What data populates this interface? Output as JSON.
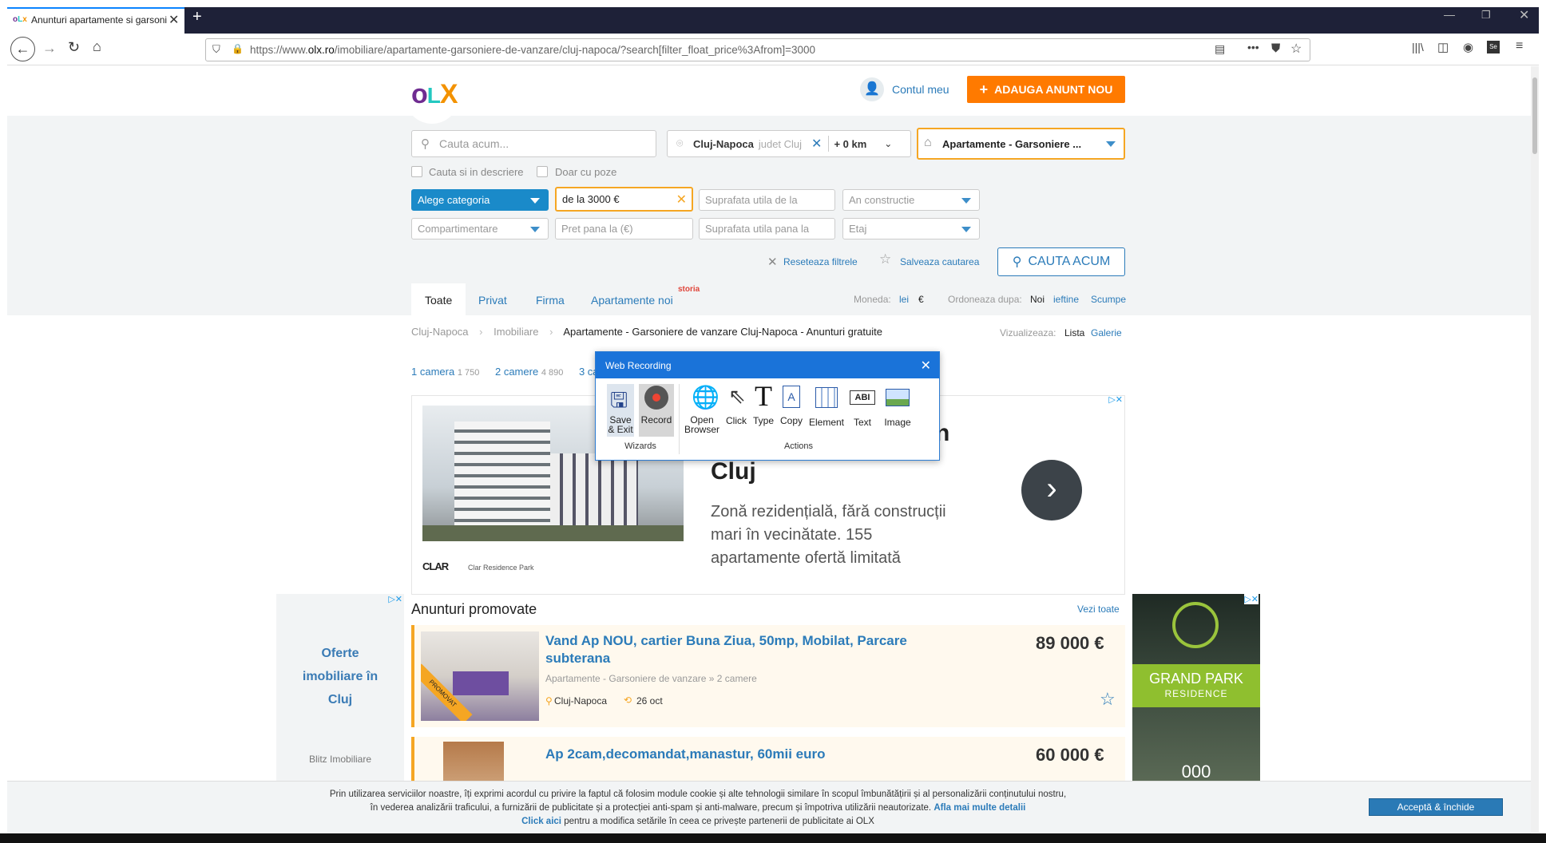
{
  "browser": {
    "tab_title": "Anunturi apartamente si garsoniere",
    "url_prefix": "https://www.",
    "url_domain": "olx.ro",
    "url_path": "/imobiliare/apartamente-garsoniere-de-vanzare/cluj-napoca/?search[filter_float_price%3Afrom]=3000"
  },
  "header": {
    "logo": "OLX",
    "account": "Contul meu",
    "post_ad": "ADAUGA ANUNT NOU"
  },
  "search": {
    "query_placeholder": "Cauta acum...",
    "city": "Cluj-Napoca",
    "county": "judet Cluj",
    "radius": "+ 0 km",
    "category": "Apartamente - Garsoniere ...",
    "desc_checkbox": "Cauta si in descriere",
    "photo_checkbox": "Doar cu poze",
    "subcategory": "Alege categoria",
    "price_from": "de la 3000 €",
    "area_from": "Suprafata utila de la",
    "year": "An constructie",
    "partitioning": "Compartimentare",
    "price_to": "Pret pana la (€)",
    "area_to": "Suprafata utila pana la",
    "floor": "Etaj",
    "reset": "Reseteaza filtrele",
    "save": "Salveaza cautarea",
    "submit": "CAUTA ACUM"
  },
  "tabs": [
    "Toate",
    "Privat",
    "Firma",
    "Apartamente noi"
  ],
  "storia": "storia",
  "currency": {
    "label": "Moneda:",
    "lei": "lei",
    "eur": "€"
  },
  "sort": {
    "label": "Ordoneaza dupa:",
    "new": "Noi",
    "cheap": "ieftine",
    "expensive": "Scumpe"
  },
  "breadcrumb": [
    "Cluj-Napoca",
    "Imobiliare",
    "Apartamente - Garsoniere de vanzare Cluj-Napoca - Anunturi gratuite"
  ],
  "view": {
    "label": "Vizualizeaza:",
    "list": "Lista",
    "gallery": "Galerie"
  },
  "rooms": [
    {
      "label": "1 camera",
      "count": "1 750"
    },
    {
      "label": "2 camere",
      "count": "4 890"
    },
    {
      "label": "3 ca",
      "count": ""
    }
  ],
  "ad_banner": {
    "title_tail": "n",
    "title_line2": "Cluj",
    "body": [
      "Zonă rezidențială, fără construcții",
      "mari în vecinătate. 155",
      "apartamente ofertă limitată"
    ],
    "brand": "CLAR",
    "brand_sub": "Clar Residence Park"
  },
  "left_ad": {
    "title": [
      "Oferte",
      "imobiliare în",
      "Cluj"
    ],
    "source": "Blitz Imobiliare"
  },
  "right_ad": {
    "brand": "GRAND PARK",
    "sub": "RESIDENCE",
    "num": "000"
  },
  "promoted": {
    "heading": "Anunturi promovate",
    "see_all": "Vezi toate",
    "items": [
      {
        "title": [
          "Vand Ap NOU, cartier Buna Ziua, 50mp, Mobilat, Parcare",
          "subterana"
        ],
        "category": "Apartamente - Garsoniere de vanzare » 2 camere",
        "location": "Cluj-Napoca",
        "date": "26 oct",
        "price": "89 000 €",
        "badge": "PROMOVAT"
      },
      {
        "title": [
          "Ap 2cam,decomandat,manastur, 60mii euro"
        ],
        "price": "60 000 €"
      }
    ]
  },
  "recorder": {
    "title": "Web Recording",
    "save": [
      "Save",
      "& Exit"
    ],
    "record": "Record",
    "open": [
      "Open",
      "Browser"
    ],
    "click": "Click",
    "type": "Type",
    "copy": "Copy",
    "element": "Element",
    "text": "Text",
    "image": "Image",
    "group_wizards": "Wizards",
    "group_actions": "Actions"
  },
  "cookie": {
    "line1": "Prin utilizarea serviciilor noastre, îți exprimi acordul cu privire la faptul că folosim module cookie și alte tehnologii similare în scopul îmbunătățirii și al personalizării conținutului nostru,",
    "line2": "în vederea analizării traficului, a furnizării de publicitate și a protecției anti-spam și anti-malware, precum și împotriva utilizării neautorizate.",
    "more": "Afla mai multe detalii",
    "click_here": "Click aici",
    "line3": "pentru a modifica setările în ceea ce privește partenerii de publicitate ai OLX",
    "accept": "Acceptă & închide"
  },
  "colors": {
    "accent": "#2b7bb9",
    "orange": "#ff7a00",
    "brand_teal": "#23e5db",
    "tab_dark": "#1e2138"
  }
}
